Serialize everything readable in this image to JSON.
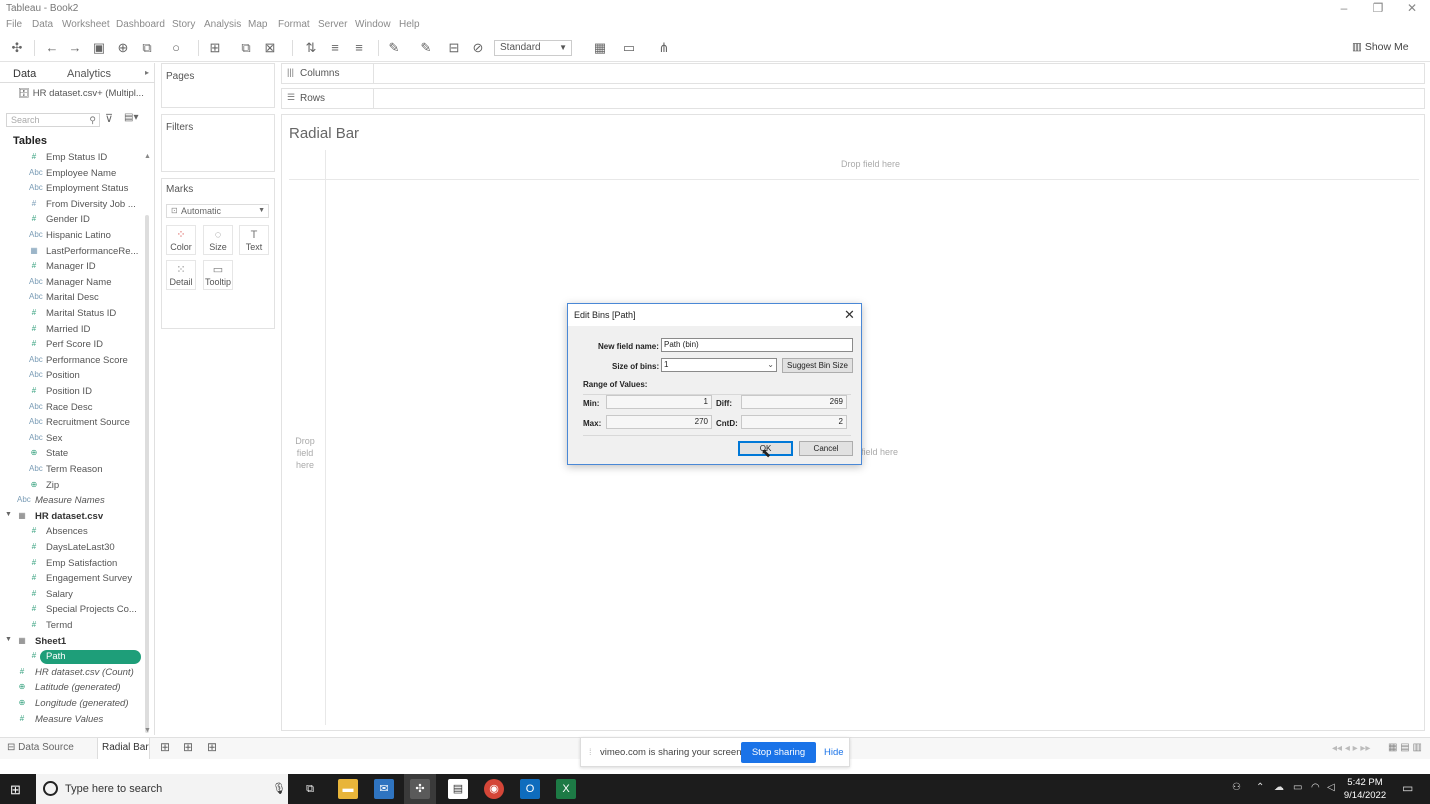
{
  "window": {
    "title": "Tableau - Book2",
    "controls": [
      "minimize-icon",
      "restore-icon",
      "close-icon"
    ]
  },
  "menu": [
    "File",
    "Data",
    "Worksheet",
    "Dashboard",
    "Story",
    "Analysis",
    "Map",
    "Format",
    "Server",
    "Window",
    "Help"
  ],
  "toolbar": {
    "fit_select": "Standard",
    "show_me": "Show Me"
  },
  "data_pane": {
    "tabs": [
      "Data",
      "Analytics"
    ],
    "datasource": "HR dataset.csv+ (Multipl...",
    "search_placeholder": "Search",
    "tables_header": "Tables",
    "fields": [
      {
        "label": "Emp Status ID",
        "type": "measure",
        "icon": "#"
      },
      {
        "label": "Employee Name",
        "type": "dimension",
        "icon": "Abc"
      },
      {
        "label": "Employment Status",
        "type": "dimension",
        "icon": "Abc"
      },
      {
        "label": "From Diversity Job ...",
        "type": "dimension",
        "icon": "#"
      },
      {
        "label": "Gender ID",
        "type": "measure",
        "icon": "#"
      },
      {
        "label": "Hispanic Latino",
        "type": "dimension",
        "icon": "Abc"
      },
      {
        "label": "LastPerformanceRe...",
        "type": "dimension",
        "icon": "date"
      },
      {
        "label": "Manager ID",
        "type": "measure",
        "icon": "#"
      },
      {
        "label": "Manager Name",
        "type": "dimension",
        "icon": "Abc"
      },
      {
        "label": "Marital Desc",
        "type": "dimension",
        "icon": "Abc"
      },
      {
        "label": "Marital Status ID",
        "type": "measure",
        "icon": "#"
      },
      {
        "label": "Married ID",
        "type": "measure",
        "icon": "#"
      },
      {
        "label": "Perf Score ID",
        "type": "measure",
        "icon": "#"
      },
      {
        "label": "Performance Score",
        "type": "dimension",
        "icon": "Abc"
      },
      {
        "label": "Position",
        "type": "dimension",
        "icon": "Abc"
      },
      {
        "label": "Position ID",
        "type": "measure",
        "icon": "#"
      },
      {
        "label": "Race Desc",
        "type": "dimension",
        "icon": "Abc"
      },
      {
        "label": "Recruitment Source",
        "type": "dimension",
        "icon": "Abc"
      },
      {
        "label": "Sex",
        "type": "dimension",
        "icon": "Abc"
      },
      {
        "label": "State",
        "type": "geo",
        "icon": "globe"
      },
      {
        "label": "Term Reason",
        "type": "dimension",
        "icon": "Abc"
      },
      {
        "label": "Zip",
        "type": "geo",
        "icon": "globe"
      },
      {
        "label": "Measure Names",
        "type": "dimension",
        "icon": "Abc"
      },
      {
        "label": "HR dataset.csv",
        "type": "group",
        "icon": "table"
      },
      {
        "label": "Absences",
        "type": "measure",
        "icon": "#"
      },
      {
        "label": "DaysLateLast30",
        "type": "measure",
        "icon": "#"
      },
      {
        "label": "Emp Satisfaction",
        "type": "measure",
        "icon": "#"
      },
      {
        "label": "Engagement Survey",
        "type": "measure",
        "icon": "#"
      },
      {
        "label": "Salary",
        "type": "measure",
        "icon": "#"
      },
      {
        "label": "Special Projects Co...",
        "type": "measure",
        "icon": "#"
      },
      {
        "label": "Termd",
        "type": "measure",
        "icon": "#"
      },
      {
        "label": "Sheet1",
        "type": "group",
        "icon": "table"
      },
      {
        "label": "Path",
        "type": "selected",
        "icon": "#"
      },
      {
        "label": "HR dataset.csv (Count)",
        "type": "measure",
        "icon": "#"
      },
      {
        "label": "Latitude (generated)",
        "type": "geo",
        "icon": "globe"
      },
      {
        "label": "Longitude (generated)",
        "type": "geo",
        "icon": "globe"
      },
      {
        "label": "Measure Values",
        "type": "measure",
        "icon": "#"
      }
    ]
  },
  "shelves": {
    "pages": "Pages",
    "filters": "Filters",
    "marks": "Marks",
    "marks_type": "Automatic",
    "mark_buttons": [
      "Color",
      "Size",
      "Text",
      "Detail",
      "Tooltip"
    ],
    "columns": "Columns",
    "rows": "Rows"
  },
  "sheet": {
    "title": "Radial Bar",
    "drop_top": "Drop field here",
    "drop_left": "Drop field here",
    "drop_right": "field here"
  },
  "dialog": {
    "title": "Edit Bins [Path]",
    "new_field_label": "New field name:",
    "new_field_value": "Path (bin)",
    "size_label": "Size of bins:",
    "size_value": "1",
    "suggest_button": "Suggest Bin Size",
    "range_label": "Range of Values:",
    "min_label": "Min:",
    "min_value": "1",
    "max_label": "Max:",
    "max_value": "270",
    "diff_label": "Diff:",
    "diff_value": "269",
    "cntd_label": "CntD:",
    "cntd_value": "2",
    "ok_button": "OK",
    "cancel_button": "Cancel"
  },
  "statusbar": {
    "data_source_tab": "Data Source",
    "sheet_tab": "Radial Bar"
  },
  "share_bar": {
    "message": "vimeo.com is sharing your screen.",
    "stop": "Stop sharing",
    "hide": "Hide"
  },
  "taskbar": {
    "search_placeholder": "Type here to search",
    "time": "5:42 PM",
    "date": "9/14/2022"
  },
  "colors": {
    "path_pill": "#1e9e79",
    "dialog_border": "#4a88d6",
    "stop_sharing": "#1a73e8"
  }
}
